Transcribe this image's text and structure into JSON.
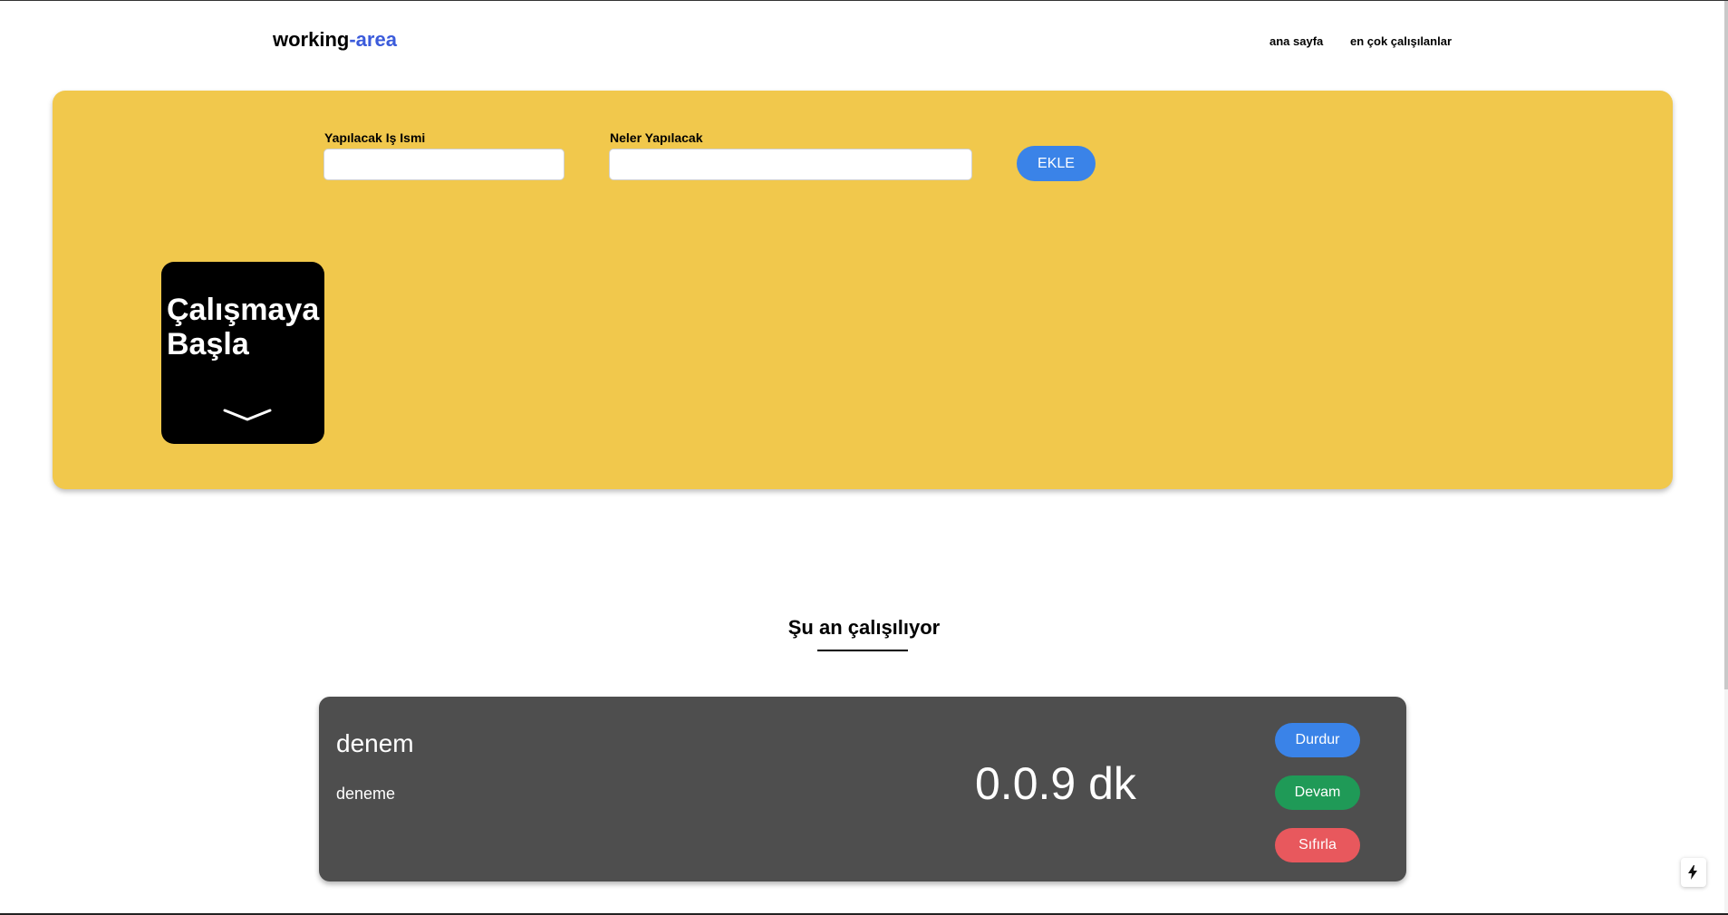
{
  "navbar": {
    "brand_part1": "working",
    "brand_part2": "-area",
    "links": [
      "ana sayfa",
      "en çok çalışılanlar"
    ]
  },
  "form": {
    "task_label": "Yapılacak Iş Ismi",
    "task_value": "",
    "desc_label": "Neler Yapılacak",
    "desc_value": "",
    "add_button": "EKLE"
  },
  "start_card": {
    "title_line1": "Çalışmaya",
    "title_line2": "Başla",
    "icon": "chevron-down-icon"
  },
  "section": {
    "heading": "Şu an çalışılıyor"
  },
  "active_job": {
    "name": "denem",
    "description": "deneme",
    "elapsed": "0.0.9 dk",
    "buttons": {
      "stop": "Durdur",
      "resume": "Devam",
      "reset": "Sıfırla"
    }
  },
  "colors": {
    "panel": "#f1c84c",
    "brand_accent": "#3b5bdb",
    "primary": "#3a83e8",
    "success": "#1f9a57",
    "danger": "#e8585d",
    "card": "#4e4e4e"
  },
  "dev_badge": {
    "icon": "lightning-icon"
  }
}
